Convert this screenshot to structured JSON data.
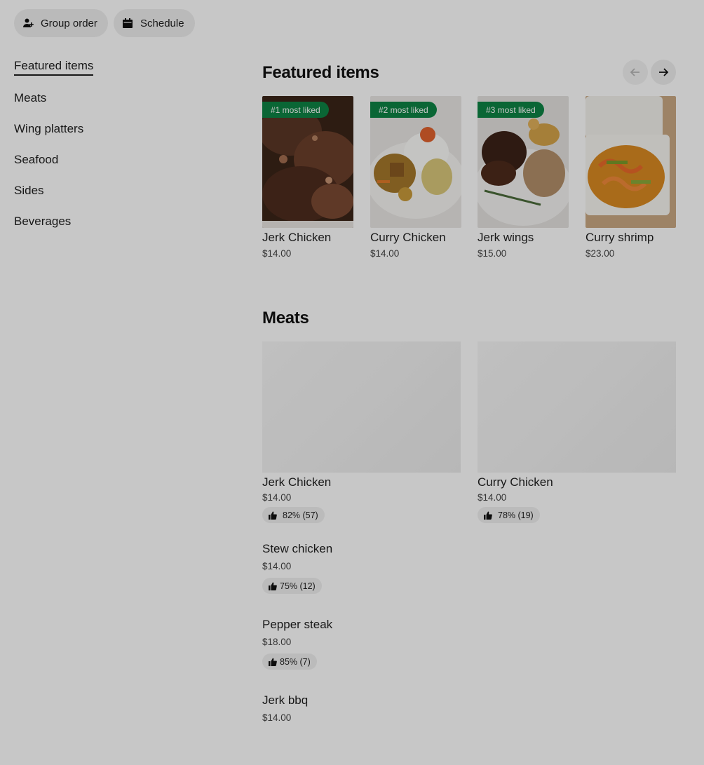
{
  "top_actions": {
    "group_order": "Group order",
    "schedule": "Schedule"
  },
  "nav": {
    "items": [
      {
        "label": "Featured items",
        "active": true
      },
      {
        "label": "Meats"
      },
      {
        "label": "Wing platters"
      },
      {
        "label": "Seafood"
      },
      {
        "label": "Sides"
      },
      {
        "label": "Beverages"
      }
    ]
  },
  "featured": {
    "title": "Featured items",
    "cards": [
      {
        "badge": "#1 most liked",
        "name": "Jerk Chicken",
        "price": "$14.00"
      },
      {
        "badge": "#2 most liked",
        "name": "Curry Chicken",
        "price": "$14.00"
      },
      {
        "badge": "#3 most liked",
        "name": "Jerk wings",
        "price": "$15.00"
      },
      {
        "name": "Curry shrimp",
        "price": "$23.00"
      }
    ]
  },
  "meats": {
    "title": "Meats",
    "grid": [
      {
        "name": "Jerk Chicken",
        "price": "$14.00",
        "rating": "82% (57)"
      },
      {
        "name": "Curry Chicken",
        "price": "$14.00",
        "rating": "78% (19)"
      }
    ],
    "list": [
      {
        "name": "Stew chicken",
        "price": "$14.00",
        "rating": "75% (12)"
      },
      {
        "name": "Pepper steak",
        "price": "$18.00",
        "rating": "85% (7)"
      },
      {
        "name": "Jerk bbq",
        "price": "$14.00"
      }
    ]
  },
  "icons": {
    "group_order": "person-plus-icon",
    "schedule": "calendar-icon",
    "prev": "arrow-left-icon",
    "next": "arrow-right-icon",
    "rating": "thumbs-up-icon"
  },
  "colors": {
    "badge": "#0e8345",
    "overlay": "rgba(0,0,0,0.22)"
  }
}
